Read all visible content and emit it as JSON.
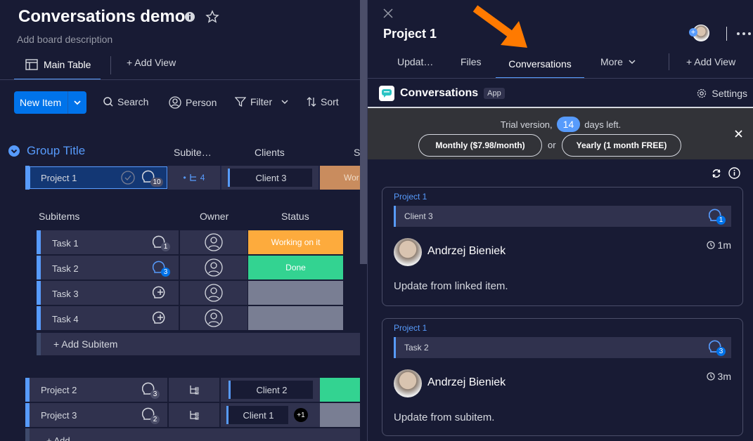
{
  "board": {
    "title": "Conversations demo",
    "description": "Add board description",
    "tab_main": "Main Table",
    "add_view": "+ Add View",
    "new_item": "New Item",
    "tools": [
      "Search",
      "Person",
      "Filter",
      "Sort"
    ],
    "group_title": "Group Title",
    "columns": [
      "Subite…",
      "Clients",
      "S"
    ],
    "project1": {
      "name": "Project 1",
      "updates": "10",
      "subitems": "4",
      "client": "Client 3",
      "status": "Wor"
    },
    "sub_headers": [
      "Subitems",
      "Owner",
      "Status"
    ],
    "tasks": [
      {
        "name": "Task 1",
        "count": "1",
        "status": "Working on it",
        "color": "#fdab3d"
      },
      {
        "name": "Task 2",
        "count": "3",
        "status": "Done",
        "color": "#33d391"
      },
      {
        "name": "Task 3",
        "count": "",
        "status": "",
        "color": "#797e93"
      },
      {
        "name": "Task 4",
        "count": "",
        "status": "",
        "color": "#797e93"
      }
    ],
    "add_subitem": "+ Add Subitem",
    "project2": {
      "name": "Project 2",
      "updates": "3",
      "client": "Client 2"
    },
    "project3": {
      "name": "Project 3",
      "updates": "2",
      "client": "Client 1",
      "extra": "+1"
    },
    "add_item": "+ Add"
  },
  "panel": {
    "title": "Project 1",
    "tabs": [
      "Updat…",
      "Files",
      "Conversations",
      "More"
    ],
    "add_view": "+ Add View",
    "app_title": "Conversations",
    "app_badge": "App",
    "settings": "Settings",
    "trial_prefix": "Trial version,",
    "trial_days": "14",
    "trial_suffix": "days left.",
    "monthly": "Monthly ($7.98/month)",
    "or": "or",
    "yearly": "Yearly (1 month FREE)",
    "cards": [
      {
        "project": "Project 1",
        "link": "Client 3",
        "link_count": "1",
        "author": "Andrzej Bieniek",
        "time": "1m",
        "body": "Update from linked item."
      },
      {
        "project": "Project 1",
        "link": "Task 2",
        "link_count": "3",
        "author": "Andrzej Bieniek",
        "time": "3m",
        "body": "Update from subitem."
      }
    ]
  },
  "colors": {
    "accent": "#579bfc",
    "primary": "#0073ea",
    "bg": "#181b34",
    "row": "#30324e",
    "working": "#fdab3d",
    "done": "#33d391",
    "arrow": "#ff7a00"
  }
}
